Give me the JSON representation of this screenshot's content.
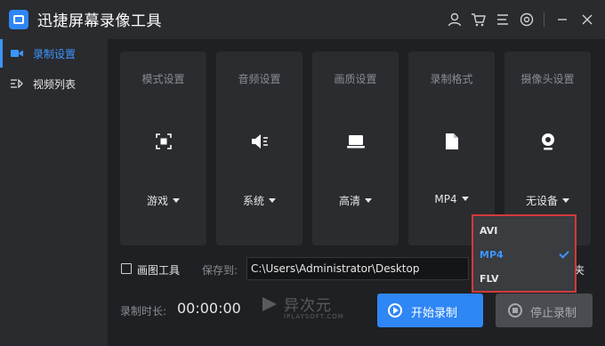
{
  "app": {
    "title": "迅捷屏幕录像工具"
  },
  "titlebar": {
    "icons": [
      "user-icon",
      "cart-icon",
      "menu-icon",
      "settings-icon",
      "minimize-icon",
      "close-icon"
    ]
  },
  "sidebar": {
    "items": [
      {
        "label": "录制设置",
        "icon": "camera-icon",
        "active": true
      },
      {
        "label": "视频列表",
        "icon": "list-icon",
        "active": false
      }
    ]
  },
  "settings": {
    "cards": [
      {
        "title": "模式设置",
        "value": "游戏",
        "icon": "mode-icon"
      },
      {
        "title": "音频设置",
        "value": "系统",
        "icon": "speaker-icon"
      },
      {
        "title": "画质设置",
        "value": "高清",
        "icon": "laptop-icon"
      },
      {
        "title": "录制格式",
        "value": "MP4",
        "icon": "file-icon"
      },
      {
        "title": "摄像头设置",
        "value": "无设备",
        "icon": "webcam-icon"
      }
    ]
  },
  "format_dropdown": {
    "options": [
      {
        "label": "AVI",
        "selected": false
      },
      {
        "label": "MP4",
        "selected": true
      },
      {
        "label": "FLV",
        "selected": false
      }
    ]
  },
  "bottom": {
    "pip_label": "画图工具",
    "save_label": "保存到:",
    "save_path": "C:\\Users\\Administrator\\Desktop",
    "folder_tail": "夹",
    "duration_label": "录制时长:",
    "duration_value": "00:00:00",
    "start_label": "开始录制",
    "stop_label": "停止录制"
  },
  "watermark": {
    "text": "异次元",
    "sub": "IPLAYSOFT.COM"
  },
  "colors": {
    "accent": "#2f86f5",
    "highlight": "#d23a3a"
  }
}
